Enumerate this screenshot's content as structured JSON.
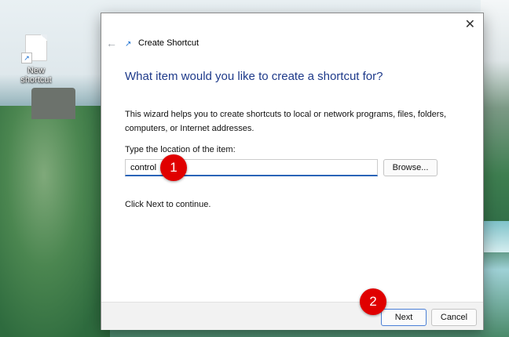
{
  "desktop": {
    "icon_label": "New shortcut",
    "icon_name": "shortcut-file-icon"
  },
  "dialog": {
    "title": "Create Shortcut",
    "heading": "What item would you like to create a shortcut for?",
    "description": "This wizard helps you to create shortcuts to local or network programs, files, folders, computers, or Internet addresses.",
    "field_label": "Type the location of the item:",
    "location_value": "control",
    "browse_label": "Browse...",
    "hint": "Click Next to continue.",
    "next_label": "Next",
    "cancel_label": "Cancel"
  },
  "annotations": {
    "marker1": "1",
    "marker2": "2",
    "color": "#e00000"
  },
  "colors": {
    "heading": "#1e3a8a",
    "accent": "#2a64b8"
  }
}
